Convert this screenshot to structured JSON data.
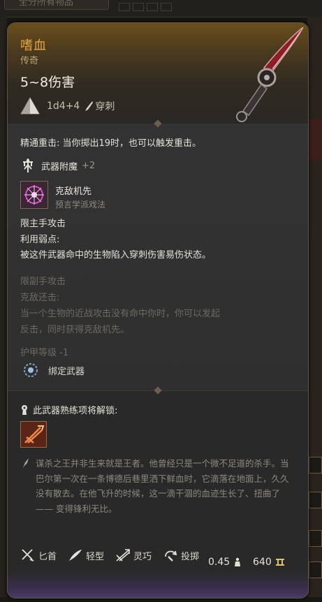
{
  "background": {
    "search_placeholder": "全分所有物品"
  },
  "item": {
    "name": "嗜血",
    "rarity": "传奇",
    "damage": "5~8伤害",
    "dice": "1d4+4",
    "damage_type": "穿刺"
  },
  "effects": {
    "crit": "精通重击: 当你掷出19时，也可以触发重击。",
    "enchant_label": "武器附魔",
    "enchant_value": "+2",
    "spell_name": "克敌机先",
    "spell_school": "预言学派戏法",
    "main_hand": "限主手攻击",
    "weakness_title": "利用弱点:",
    "weakness_desc": "被这件武器命中的生物陷入穿刺伤害易伤状态。",
    "offhand": "限副手攻击",
    "counter_title": "克敌还击:",
    "counter_desc_1": "当一个生物的近战攻击没有命中你时，你可以发起",
    "counter_desc_2": "反击，同时获得克敌机先。",
    "ac": "护甲等级 -1",
    "bind": "绑定武器"
  },
  "proficiency": {
    "unlock_label": "此武器熟练项将解锁:"
  },
  "lore": "谋杀之王并非生来就是王者。他曾经只是一个微不足道的杀手。当巴尔第一次在一条博德后巷里洒下鲜血时，它滴落在地面上，久久没有散去。在他飞升的时候，这一滴干涸的血迹生长了、扭曲了 —— 变得锋利无比。",
  "properties": [
    {
      "label": "匕首",
      "icon": "dagger-icon"
    },
    {
      "label": "轻型",
      "icon": "feather-icon"
    },
    {
      "label": "灵巧",
      "icon": "finesse-icon"
    },
    {
      "label": "投掷",
      "icon": "throw-icon"
    }
  ],
  "footer": {
    "weight": "0.45",
    "value": "640"
  },
  "colors": {
    "title": "#e8a63a",
    "frame": "#5b554b",
    "footer_purple": "#4a3a66"
  }
}
